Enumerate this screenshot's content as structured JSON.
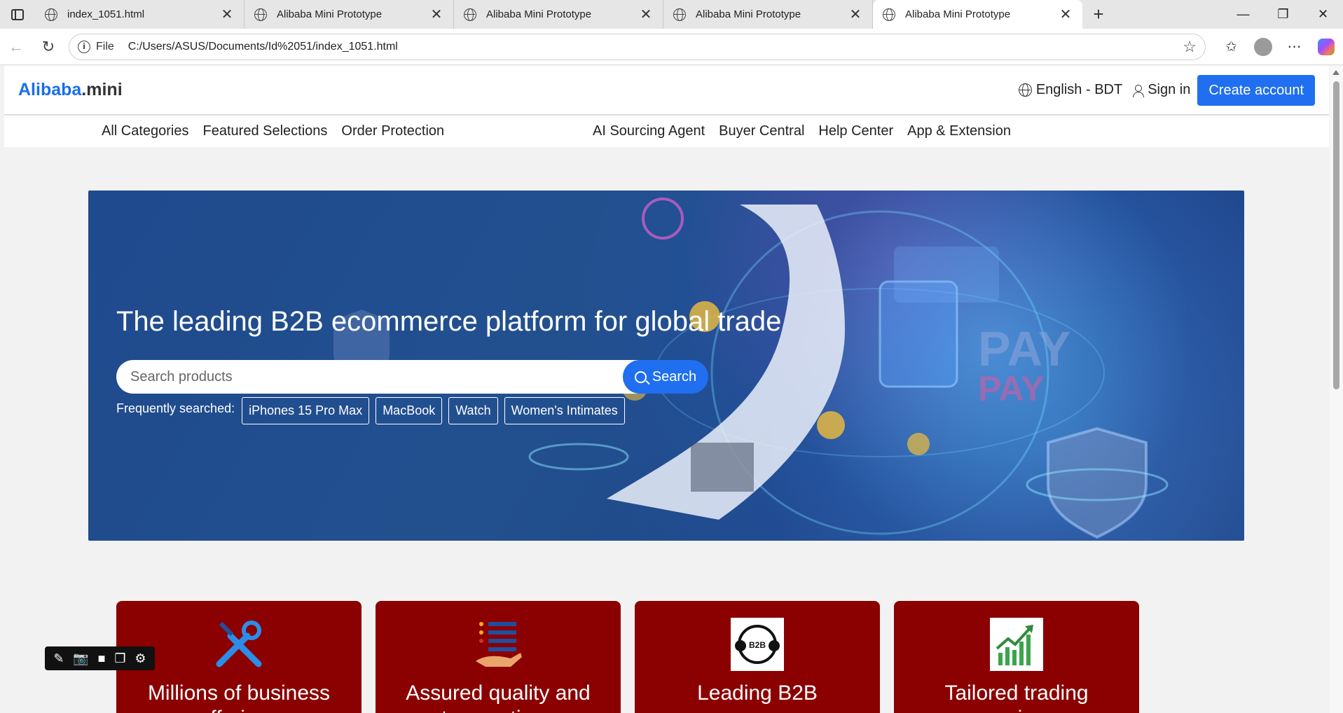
{
  "browser": {
    "tabs": [
      {
        "title": "index_1051.html",
        "active": false
      },
      {
        "title": "Alibaba Mini Prototype",
        "active": false
      },
      {
        "title": "Alibaba Mini Prototype",
        "active": false
      },
      {
        "title": "Alibaba Mini Prototype",
        "active": false
      },
      {
        "title": "Alibaba Mini Prototype",
        "active": true
      }
    ],
    "new_tab": "+",
    "address": {
      "scheme_label": "File",
      "url": "C:/Users/ASUS/Documents/Id%2051/index_1051.html"
    }
  },
  "header": {
    "logo_main": "Alibaba",
    "logo_suffix": ".mini",
    "language": "English - BDT",
    "sign_in": "Sign in",
    "create_account": "Create account"
  },
  "nav": {
    "left": [
      "All Categories",
      "Featured Selections",
      "Order Protection"
    ],
    "right": [
      "AI Sourcing Agent",
      "Buyer Central",
      "Help Center",
      "App & Extension"
    ]
  },
  "hero": {
    "title": "The leading B2B ecommerce platform for global trade",
    "search_placeholder": "Search products",
    "search_button": "Search",
    "frequently_label": "Frequently searched:",
    "chips": [
      "iPhones 15 Pro Max",
      "MacBook",
      "Watch",
      "Women's Intimates"
    ]
  },
  "cards": [
    {
      "title": "Millions of business offerings",
      "icon": "tools-icon"
    },
    {
      "title": "Assured quality and transactions",
      "icon": "quality-list-icon"
    },
    {
      "title": "Leading B2B",
      "icon": "b2b-cycle-icon"
    },
    {
      "title": "Tailored trading experience",
      "icon": "growth-chart-icon"
    }
  ],
  "colors": {
    "brand_blue": "#1f6ff0",
    "card_red": "#8b0000",
    "hero_blue": "#22508f"
  }
}
